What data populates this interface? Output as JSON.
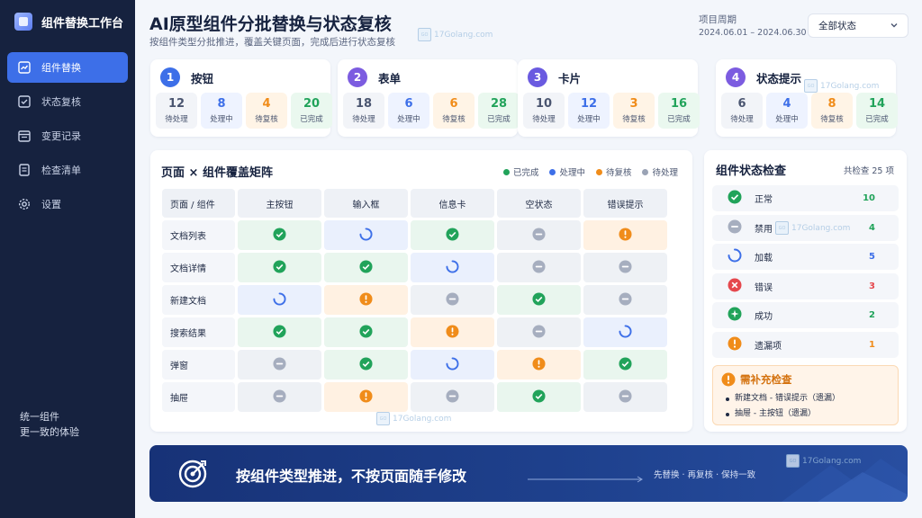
{
  "app": {
    "title": "组件替换工作台",
    "footer_line1": "统一组件",
    "footer_line2": "更一致的体验"
  },
  "sidebar": {
    "items": [
      {
        "label": "组件替换",
        "icon": "chart-trend-icon",
        "active": true
      },
      {
        "label": "状态复核",
        "icon": "checkbox-icon",
        "active": false
      },
      {
        "label": "变更记录",
        "icon": "calendar-icon",
        "active": false
      },
      {
        "label": "检查清单",
        "icon": "clipboard-icon",
        "active": false
      },
      {
        "label": "设置",
        "icon": "gear-icon",
        "active": false
      }
    ]
  },
  "header": {
    "title": "AI原型组件分批替换与状态复核",
    "subtitle": "按组件类型分批推进，覆盖关键页面，完成后进行状态复核",
    "period_label": "项目周期",
    "period_value": "2024.06.01 – 2024.06.30",
    "status_filter": "全部状态"
  },
  "categories": [
    {
      "num": "1",
      "name": "按钮",
      "color": "#3d6fe8",
      "pending": "12",
      "processing": "8",
      "review": "4",
      "done": "20"
    },
    {
      "num": "2",
      "name": "表单",
      "color": "#7c5ce0",
      "pending": "18",
      "processing": "6",
      "review": "6",
      "done": "28"
    },
    {
      "num": "3",
      "name": "卡片",
      "color": "#6a5ae0",
      "pending": "10",
      "processing": "12",
      "review": "3",
      "done": "16"
    },
    {
      "num": "4",
      "name": "状态提示",
      "color": "#7c5ce0",
      "pending": "6",
      "processing": "4",
      "review": "8",
      "done": "14"
    }
  ],
  "stat_labels": {
    "pending": "待处理",
    "processing": "处理中",
    "review": "待复核",
    "done": "已完成"
  },
  "matrix": {
    "title": "页面 × 组件覆盖矩阵",
    "corner": "页面 / 组件",
    "legend": [
      {
        "label": "已完成",
        "color": "#21a35a"
      },
      {
        "label": "处理中",
        "color": "#3d6fe8"
      },
      {
        "label": "待复核",
        "color": "#f08c1a"
      },
      {
        "label": "待处理",
        "color": "#9aa3b5"
      }
    ],
    "columns": [
      "主按钮",
      "输入框",
      "信息卡",
      "空状态",
      "错误提示"
    ],
    "rows": [
      {
        "label": "文档列表",
        "cells": [
          "done",
          "proc",
          "done",
          "pend",
          "rev"
        ]
      },
      {
        "label": "文档详情",
        "cells": [
          "done",
          "done",
          "proc",
          "pend",
          "pend"
        ]
      },
      {
        "label": "新建文档",
        "cells": [
          "proc",
          "rev",
          "pend",
          "done",
          "pend"
        ]
      },
      {
        "label": "搜索结果",
        "cells": [
          "done",
          "done",
          "rev",
          "pend",
          "proc"
        ]
      },
      {
        "label": "弹窗",
        "cells": [
          "pend",
          "done",
          "proc",
          "rev",
          "done"
        ]
      },
      {
        "label": "抽屉",
        "cells": [
          "pend",
          "rev",
          "pend",
          "done",
          "pend"
        ]
      }
    ]
  },
  "checks": {
    "title": "组件状态检查",
    "total": "共检查 25 项",
    "items": [
      {
        "label": "正常",
        "count": "10",
        "icon": "check-circle-icon",
        "color": "#21a35a",
        "bg": "#f4f6fa"
      },
      {
        "label": "禁用",
        "count": "4",
        "icon": "minus-circle-icon",
        "color": "#21a35a",
        "bg": "#f4f6fa"
      },
      {
        "label": "加载",
        "count": "5",
        "icon": "loading-icon",
        "color": "#3d6fe8",
        "bg": "#f4f6fa"
      },
      {
        "label": "错误",
        "count": "3",
        "icon": "error-icon",
        "color": "#e5484d",
        "bg": "#f4f6fa"
      },
      {
        "label": "成功",
        "count": "2",
        "icon": "sparkle-icon",
        "color": "#21a35a",
        "bg": "#f4f6fa"
      },
      {
        "label": "遗漏项",
        "count": "1",
        "icon": "warning-icon",
        "color": "#f08c1a",
        "bg": "#f4f6fa"
      }
    ],
    "todo_title": "需补充检查",
    "todo_items": [
      "新建文档 - 错误提示（遗漏）",
      "抽屉 - 主按钮（遗漏）"
    ]
  },
  "banner": {
    "text": "按组件类型推进，不按页面随手修改",
    "steps": "先替换 · 再复核 · 保持一致"
  },
  "watermark": "17Golang.com"
}
